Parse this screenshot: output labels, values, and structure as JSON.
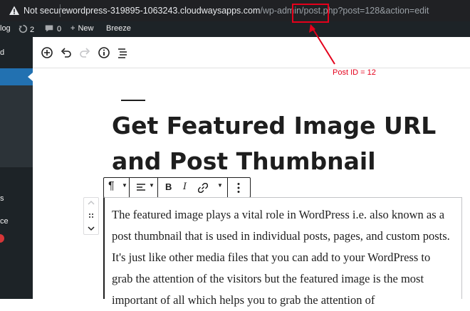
{
  "browser": {
    "security_label": "Not secure",
    "url_host": "wordpress-319895-1063243.cloudwaysapps.com",
    "url_path": "/wp-admin/post.php?post=128&action=edit"
  },
  "admin_bar": {
    "site_label": "log",
    "updates_count": "2",
    "comments_count": "0",
    "new_label": "New",
    "breeze_label": "Breeze"
  },
  "sidebar": {
    "items": [
      "d",
      "s",
      "ce"
    ]
  },
  "editor": {
    "title": "Get Featured Image URL and Post Thumbnail",
    "paragraph": "The featured image plays a vital role in WordPress i.e. also known as a  post thumbnail that is used in individual posts, pages, and custom posts. It's just like other media files that you can add to your WordPress to grab the attention of the visitors but the featured image is the most important of all which helps you to grab the attention of",
    "block_toolbar": {
      "paragraph_icon": "¶",
      "bold": "B",
      "italic": "I"
    }
  },
  "annotation": {
    "label": "Post ID = 12",
    "color": "#e4001b"
  },
  "icons": [
    "warning-icon",
    "updates-icon",
    "comments-icon",
    "plus-icon",
    "block-inserter-icon",
    "undo-icon",
    "redo-icon",
    "info-icon",
    "list-view-icon",
    "paragraph-icon",
    "align-icon",
    "link-icon",
    "more-options-icon",
    "drag-handle-icon",
    "chevron-up-icon",
    "chevron-down-icon"
  ]
}
